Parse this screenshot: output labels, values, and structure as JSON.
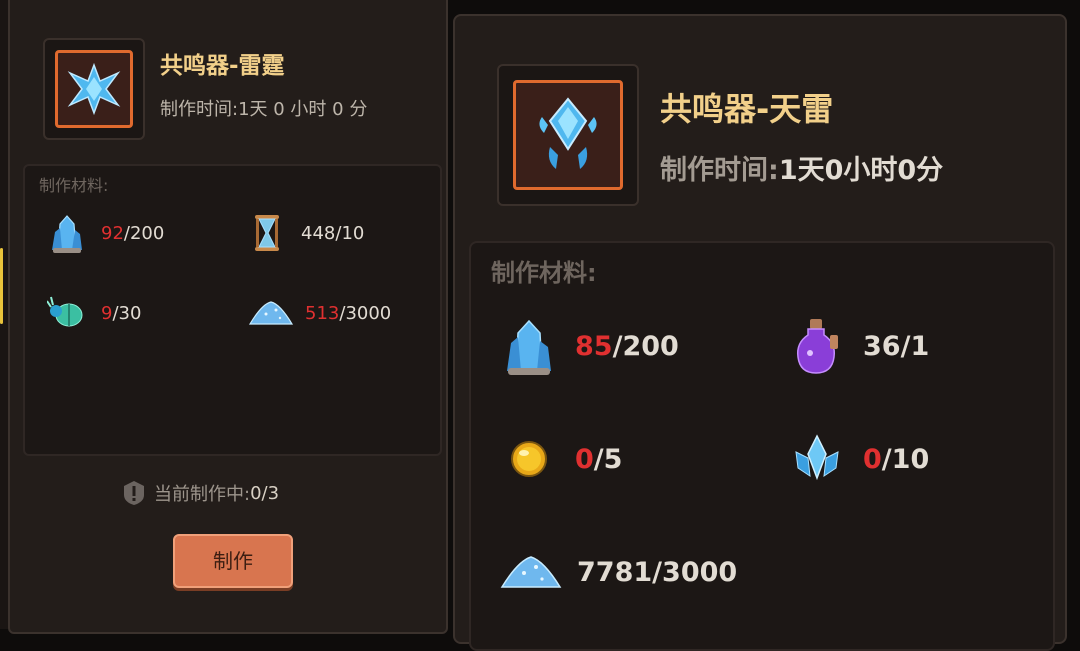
{
  "left": {
    "item_name": "共鸣器-雷霆",
    "craft_time_label": "制作时间:",
    "craft_time_value": "1天 0 小时 0 分",
    "materials_label": "制作材料:",
    "materials": [
      {
        "icon": "crystal-cluster-icon",
        "have": "92",
        "need": "200",
        "insufficient": true
      },
      {
        "icon": "hourglass-icon",
        "have": "448",
        "need": "10",
        "insufficient": false
      },
      {
        "icon": "beetle-icon",
        "have": "9",
        "need": "30",
        "insufficient": true
      },
      {
        "icon": "blue-powder-icon",
        "have": "513",
        "need": "3000",
        "insufficient": true
      }
    ],
    "crafting_status_label": "当前制作中:",
    "crafting_status_value": "0/3",
    "craft_button": "制作"
  },
  "right": {
    "item_name": "共鸣器-天雷",
    "craft_time_label": "制作时间:",
    "craft_time_value": "1天0小时0分",
    "materials_label": "制作材料:",
    "materials": [
      {
        "icon": "crystal-cluster-icon",
        "have": "85",
        "need": "200",
        "insufficient": true
      },
      {
        "icon": "purple-potion-icon",
        "have": "36",
        "need": "1",
        "insufficient": false
      },
      {
        "icon": "gold-orb-icon",
        "have": "0",
        "need": "5",
        "insufficient": true
      },
      {
        "icon": "ice-crystal-icon",
        "have": "0",
        "need": "10",
        "insufficient": true
      },
      {
        "icon": "blue-powder-icon",
        "have": "7781",
        "need": "3000",
        "insufficient": false
      }
    ]
  },
  "colors": {
    "accent": "#e06a2e",
    "title": "#f2d08a",
    "insufficient": "#e03030",
    "button": "#d8754f"
  }
}
